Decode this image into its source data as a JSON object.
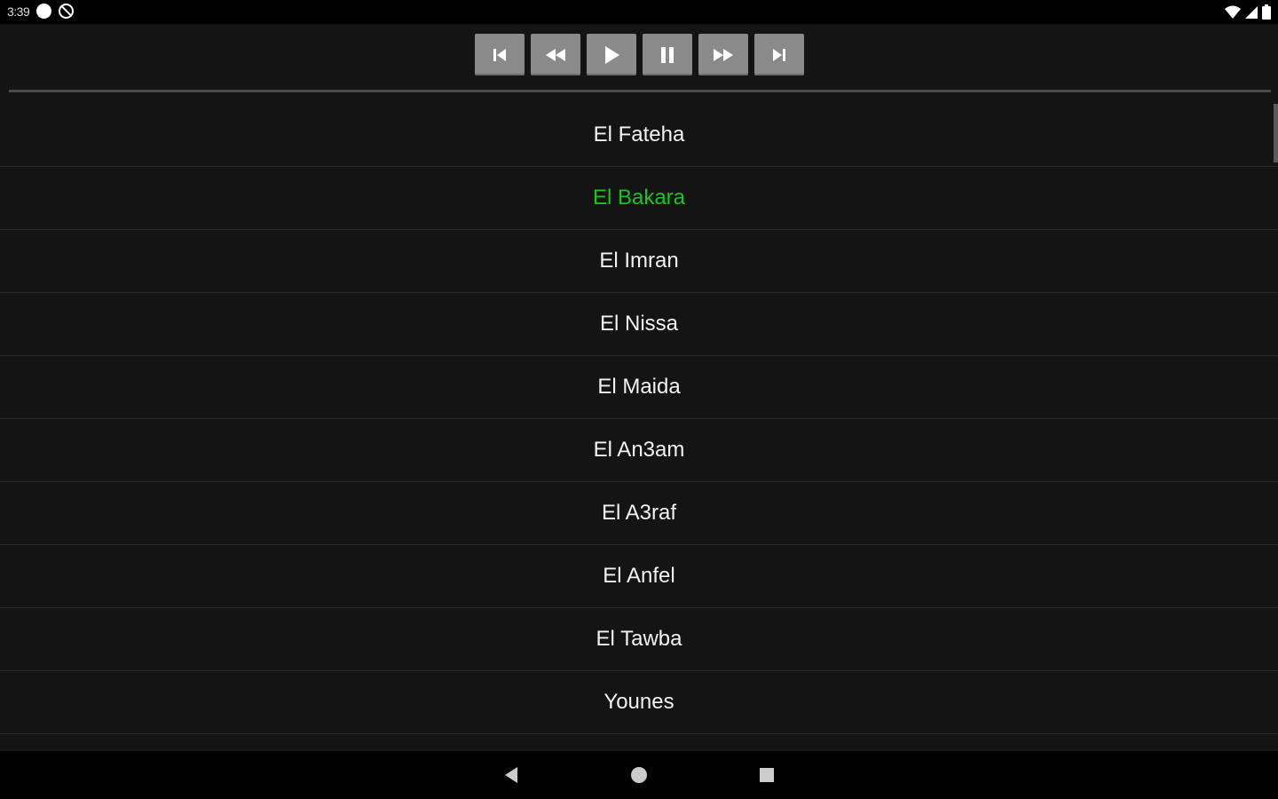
{
  "status": {
    "time": "3:39",
    "icons": [
      "dot-icon",
      "no-sync-icon",
      "wifi-icon",
      "signal-icon",
      "battery-icon"
    ]
  },
  "controls": {
    "buttons": [
      "skip-previous-icon",
      "rewind-icon",
      "play-icon",
      "pause-icon",
      "fast-forward-icon",
      "skip-next-icon"
    ]
  },
  "tracks": {
    "items": [
      {
        "label": "El Fateha"
      },
      {
        "label": "El Bakara"
      },
      {
        "label": "El Imran"
      },
      {
        "label": "El Nissa"
      },
      {
        "label": "El Maida"
      },
      {
        "label": "El An3am"
      },
      {
        "label": "El A3raf"
      },
      {
        "label": "El Anfel"
      },
      {
        "label": "El Tawba"
      },
      {
        "label": "Younes"
      }
    ],
    "active_index": 1
  },
  "colors": {
    "background": "#141414",
    "button": "#8a8a8a",
    "active_text": "#19c41d",
    "text": "#f2f2f2"
  },
  "nav": {
    "icons": [
      "back-icon",
      "home-icon",
      "recents-icon"
    ]
  }
}
